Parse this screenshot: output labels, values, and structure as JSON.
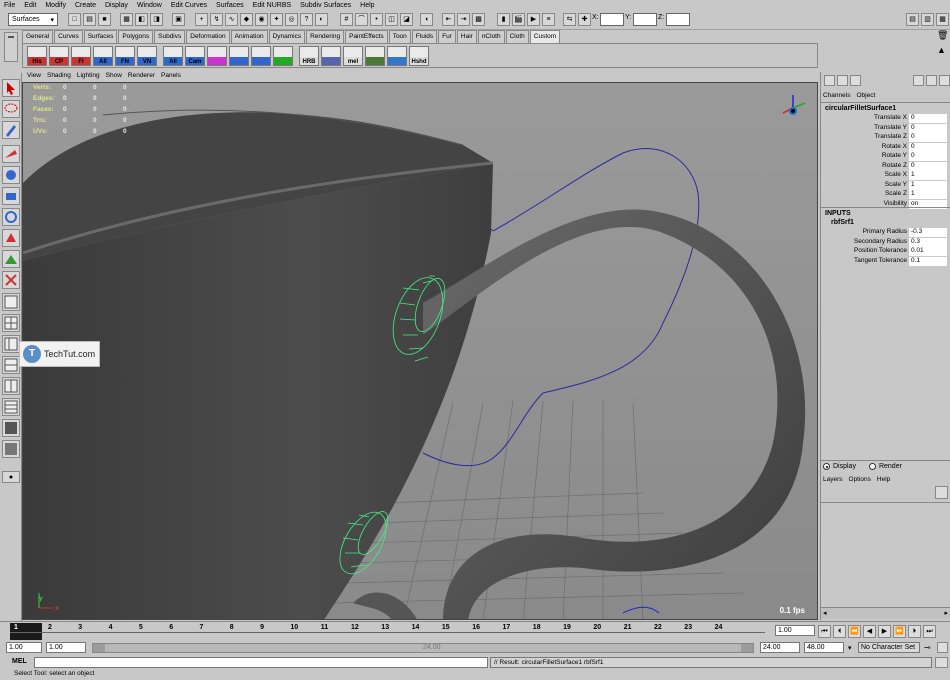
{
  "menu": [
    "File",
    "Edit",
    "Modify",
    "Create",
    "Display",
    "Window",
    "Edit Curves",
    "Surfaces",
    "Edit NURBS",
    "Subdiv Surfaces",
    "Help"
  ],
  "status": {
    "mode": "Surfaces",
    "x_label": "X:",
    "y_label": "Y:",
    "z_label": "Z:"
  },
  "shelf_tabs": [
    "General",
    "Curves",
    "Surfaces",
    "Polygons",
    "Subdivs",
    "Deformation",
    "Animation",
    "Dynamics",
    "Rendering",
    "PaintEffects",
    "Toon",
    "Fluids",
    "Fur",
    "Hair",
    "nCloth",
    "Cloth",
    "Custom"
  ],
  "shelf_buttons": [
    "His",
    "CP",
    "FI",
    "All",
    "FN",
    "VN",
    "All",
    "Cam",
    "",
    "",
    "",
    "",
    "HRB",
    "",
    "mel",
    "",
    "",
    "Hshd"
  ],
  "viewport": {
    "menu": [
      "View",
      "Shading",
      "Lighting",
      "Show",
      "Renderer",
      "Panels"
    ],
    "hud_labels": [
      "Verts:",
      "Edges:",
      "Faces:",
      "Tris:",
      "UVs:"
    ],
    "hud_values": [
      [
        "0",
        "0",
        "0"
      ],
      [
        "0",
        "0",
        "0"
      ],
      [
        "0",
        "0",
        "0"
      ],
      [
        "0",
        "0",
        "0"
      ],
      [
        "0",
        "0",
        "0"
      ]
    ],
    "fps": "0.1 fps",
    "axis_x": "x",
    "axis_y": "y",
    "watermark": "TechTut.com"
  },
  "channel_box": {
    "tabs": [
      "Channels",
      "Object"
    ],
    "node": "circularFilletSurface1",
    "attributes": [
      {
        "label": "Translate X",
        "value": "0"
      },
      {
        "label": "Translate Y",
        "value": "0"
      },
      {
        "label": "Translate Z",
        "value": "0"
      },
      {
        "label": "Rotate X",
        "value": "0"
      },
      {
        "label": "Rotate Y",
        "value": "0"
      },
      {
        "label": "Rotate Z",
        "value": "0"
      },
      {
        "label": "Scale X",
        "value": "1"
      },
      {
        "label": "Scale Y",
        "value": "1"
      },
      {
        "label": "Scale Z",
        "value": "1"
      },
      {
        "label": "Visibility",
        "value": "on"
      }
    ],
    "inputs_header": "INPUTS",
    "input_node": "rbfSrf1",
    "inputs": [
      {
        "label": "Primary Radius",
        "value": "-0.3"
      },
      {
        "label": "Secondary Radius",
        "value": "0.3"
      },
      {
        "label": "Position Tolerance",
        "value": "0.01"
      },
      {
        "label": "Tangent Tolerance",
        "value": "0.1"
      }
    ]
  },
  "layer_editor": {
    "display": "Display",
    "render": "Render",
    "menu": [
      "Layers",
      "Options",
      "Help"
    ]
  },
  "timeline": {
    "ticks": [
      "1",
      "2",
      "3",
      "4",
      "5",
      "6",
      "7",
      "8",
      "9",
      "10",
      "11",
      "12",
      "13",
      "14",
      "15",
      "16",
      "17",
      "18",
      "19",
      "20",
      "21",
      "22",
      "23",
      "24"
    ],
    "current_frame": "1.00",
    "current_marker": "1"
  },
  "range": {
    "start": "1.00",
    "inner_start": "1.00",
    "mid_label": "24.00",
    "end": "24.00",
    "max": "48.00",
    "character": "No Character Set"
  },
  "command": {
    "label": "MEL",
    "result": "// Result: circularFilletSurface1 rbfSrf1"
  },
  "help_line": "Select Tool: select an object"
}
